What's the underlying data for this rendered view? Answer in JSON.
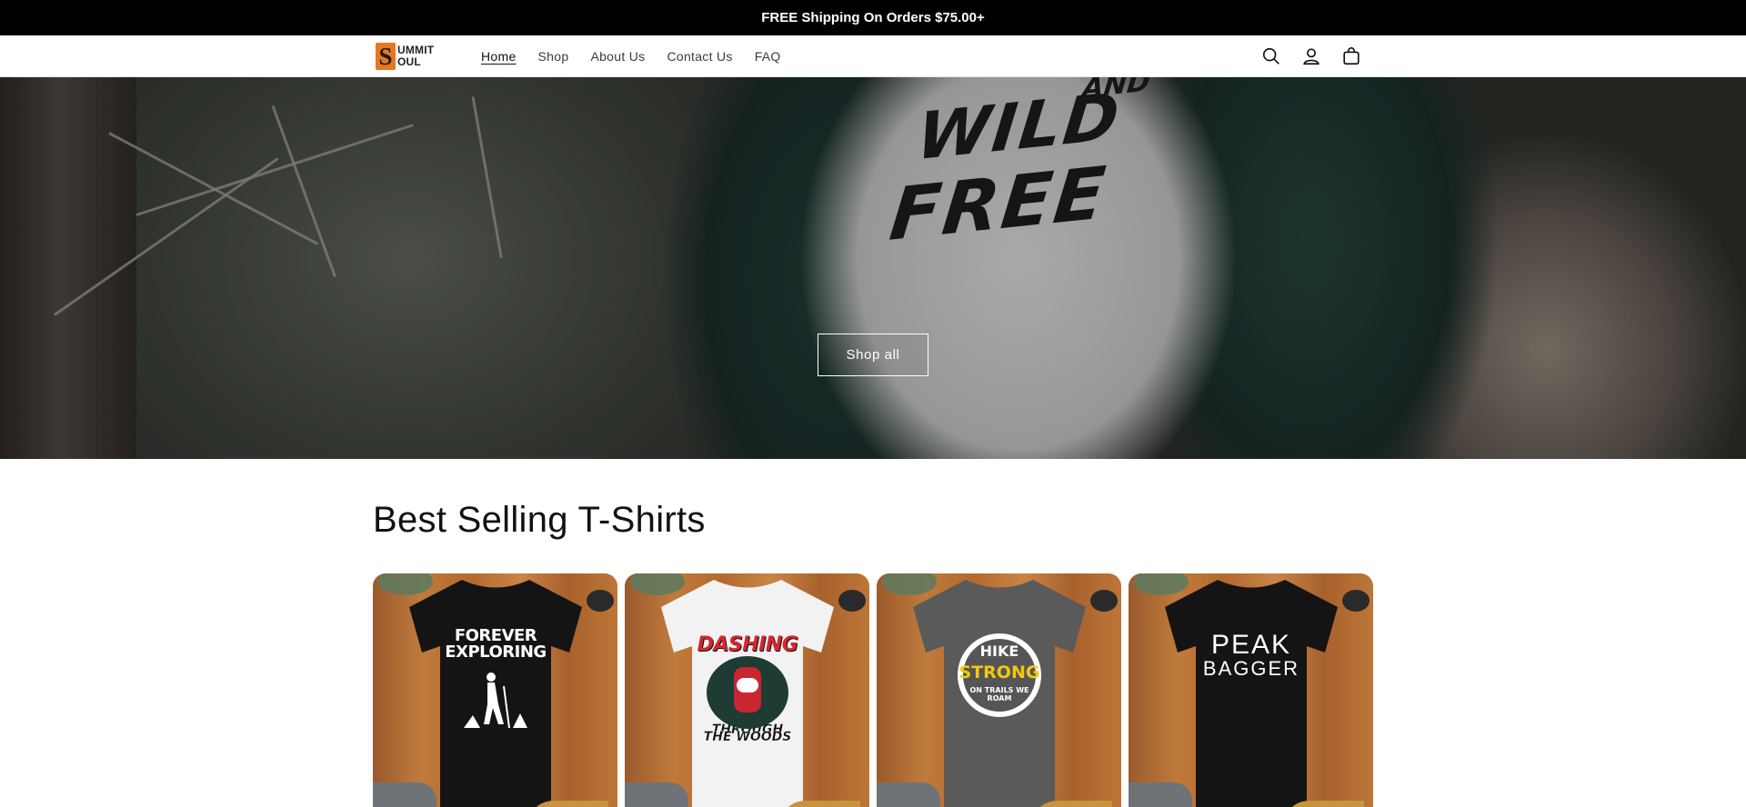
{
  "announcement": {
    "text": "FREE Shipping On Orders $75.00+"
  },
  "header": {
    "logo": {
      "initial": "S",
      "line1": "UMMIT",
      "line2": "OUL"
    },
    "nav": [
      {
        "label": "Home",
        "active": true
      },
      {
        "label": "Shop",
        "active": false
      },
      {
        "label": "About Us",
        "active": false
      },
      {
        "label": "Contact Us",
        "active": false
      },
      {
        "label": "FAQ",
        "active": false
      }
    ],
    "icons": [
      "search-icon",
      "account-icon",
      "cart-icon"
    ]
  },
  "hero": {
    "shirt_print": {
      "line1": "WILD",
      "and": "AND",
      "line2": "FREE"
    },
    "button_label": "Shop all"
  },
  "section": {
    "title": "Best Selling T-Shirts",
    "products": [
      {
        "shirt_color": "#141414",
        "design": {
          "line1": "FOREVER",
          "line2": "EXPLORING"
        }
      },
      {
        "shirt_color": "#f2f2f2",
        "design": {
          "title": "DASHING",
          "line1": "THROUGH",
          "line2": "THE WOODS"
        }
      },
      {
        "shirt_color": "#5a5a5a",
        "design": {
          "line1": "HIKE",
          "line2": "STRONG",
          "line3": "ON TRAILS WE ROAM"
        }
      },
      {
        "shirt_color": "#141414",
        "design": {
          "line1": "PEAK",
          "line2": "BAGGER"
        }
      }
    ]
  },
  "colors": {
    "announcement_bg": "#000000",
    "text": "#121212",
    "accent_logo": "#e87722"
  }
}
